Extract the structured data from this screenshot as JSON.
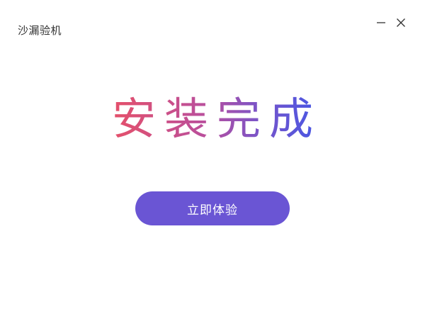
{
  "window": {
    "title": "沙漏验机",
    "controls": {
      "minimize_icon": "minimize-icon",
      "close_icon": "close-icon"
    }
  },
  "main": {
    "headline": "安装完成",
    "cta_label": "立即体验"
  },
  "colors": {
    "accent": "#6a55d4",
    "gradient_start": "#e5506a",
    "gradient_end": "#4457e6",
    "background": "#ffffff"
  }
}
